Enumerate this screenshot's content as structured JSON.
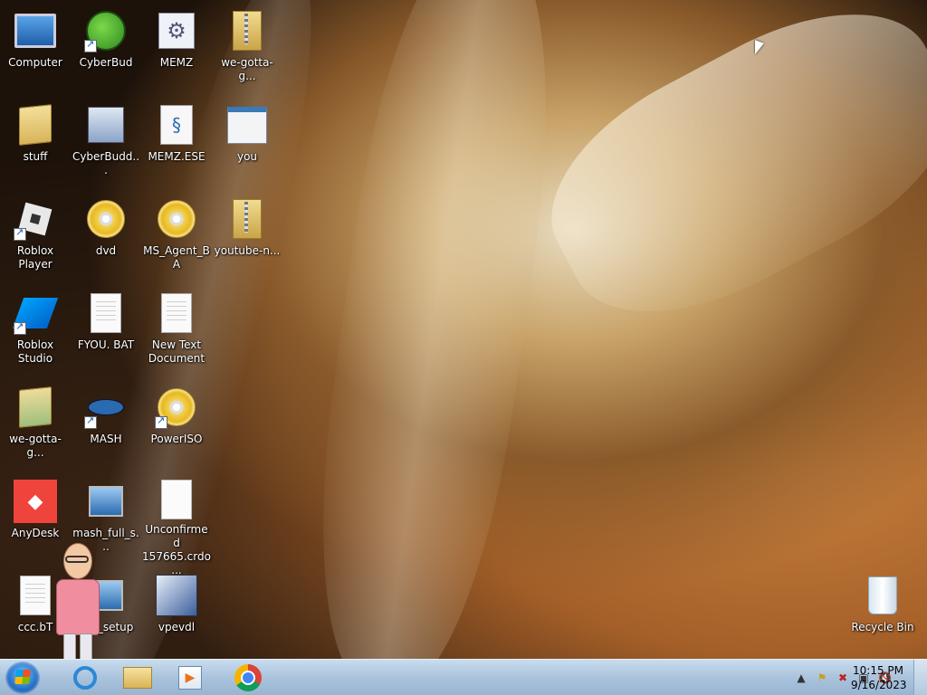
{
  "desktop_icons": [
    {
      "label": "Computer"
    },
    {
      "label": "CyberBud"
    },
    {
      "label": "MEMZ"
    },
    {
      "label": "we-gotta-g..."
    },
    {
      "label": "stuff"
    },
    {
      "label": "CyberBudd..."
    },
    {
      "label": "MEMZ.ESE"
    },
    {
      "label": "you"
    },
    {
      "label": "Roblox Player"
    },
    {
      "label": "dvd"
    },
    {
      "label": "MS_Agent_BA"
    },
    {
      "label": "youtube-n..."
    },
    {
      "label": "Roblox Studio"
    },
    {
      "label": "FYOU. BAT"
    },
    {
      "label": "New Text Document"
    },
    {
      "label": "we-gotta-g..."
    },
    {
      "label": "MASH"
    },
    {
      "label": "PowerISO"
    },
    {
      "label": "AnyDesk"
    },
    {
      "label": "mash_full_s..."
    },
    {
      "label": "Unconfirmed 157665.crdo..."
    },
    {
      "label": "ccc.bT"
    },
    {
      "label": "ash_setup"
    },
    {
      "label": "vpevdl"
    },
    {
      "label": "Recycle Bin"
    }
  ],
  "taskbar": {
    "clock_time": "10:15 PM",
    "clock_date": "9/16/2023",
    "tray_icons": [
      "show-hidden-icons",
      "action-center-flag",
      "network-error-icon",
      "display-icon",
      "volume-muted-icon"
    ]
  },
  "colors": {
    "taskbar_bg": "#a9c3dc",
    "anydesk_red": "#ef443b"
  }
}
